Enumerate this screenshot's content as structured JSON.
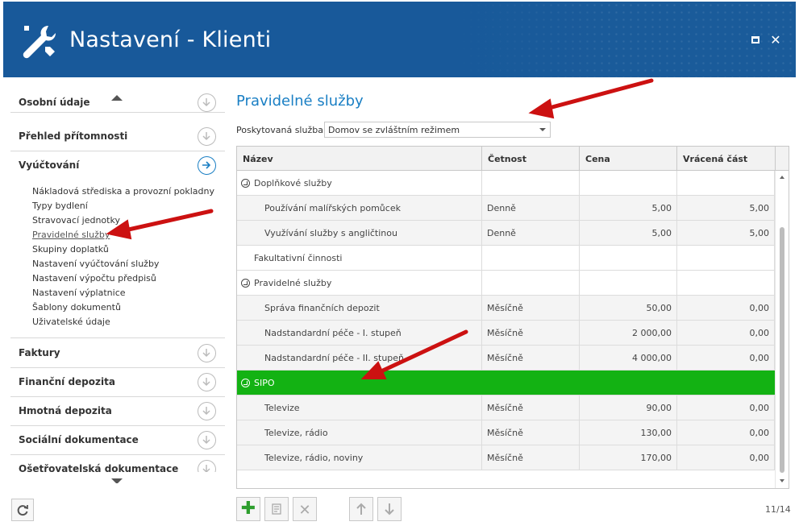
{
  "window": {
    "title": "Nastavení - Klienti",
    "icon": "wrench-screwdriver-icon",
    "title_color": "#1a5b9a"
  },
  "sidebar": {
    "sections_top": [
      {
        "label": "Osobní údaje"
      },
      {
        "label": "Přehled přítomnosti"
      },
      {
        "label": "Vyúčtování",
        "expanded": true
      }
    ],
    "subitems": [
      {
        "label": "Nákladová střediska a provozní pokladny"
      },
      {
        "label": "Typy bydlení"
      },
      {
        "label": "Stravovací jednotky"
      },
      {
        "label": "Pravidelné služby",
        "selected": true
      },
      {
        "label": "Skupiny doplatků"
      },
      {
        "label": "Nastavení vyúčtování služby"
      },
      {
        "label": "Nastavení výpočtu předpisů"
      },
      {
        "label": "Nastavení výplatnice"
      },
      {
        "label": "Šablony dokumentů"
      },
      {
        "label": "Uživatelské údaje"
      }
    ],
    "sections_bottom": [
      {
        "label": "Faktury"
      },
      {
        "label": "Finanční depozita"
      },
      {
        "label": "Hmotná depozita"
      },
      {
        "label": "Sociální dokumentace"
      },
      {
        "label": "Ošetřovatelská dokumentace"
      }
    ]
  },
  "main": {
    "title": "Pravidelné služby",
    "filter": {
      "label": "Poskytovaná služba:",
      "value": "Domov se zvláštním režimem"
    },
    "columns": [
      "Název",
      "Četnost",
      "Cena",
      "Vrácená část"
    ],
    "rows": [
      {
        "type": "group",
        "name": "Doplňkové služby",
        "freq": "",
        "price": "",
        "refund": ""
      },
      {
        "type": "item",
        "name": "Používání malířských pomůcek",
        "freq": "Denně",
        "price": "5,00",
        "refund": "5,00"
      },
      {
        "type": "item",
        "name": "Využívání služby s angličtinou",
        "freq": "Denně",
        "price": "5,00",
        "refund": "5,00"
      },
      {
        "type": "group-noicon",
        "name": "Fakultativní činnosti",
        "freq": "",
        "price": "",
        "refund": ""
      },
      {
        "type": "group",
        "name": "Pravidelné služby",
        "freq": "",
        "price": "",
        "refund": ""
      },
      {
        "type": "item",
        "name": "Správa finančních depozit",
        "freq": "Měsíčně",
        "price": "50,00",
        "refund": "0,00"
      },
      {
        "type": "item",
        "name": "Nadstandardní péče - I. stupeň",
        "freq": "Měsíčně",
        "price": "2 000,00",
        "refund": "0,00"
      },
      {
        "type": "item",
        "name": "Nadstandardní péče - II. stupeň",
        "freq": "Měsíčně",
        "price": "4 000,00",
        "refund": "0,00"
      },
      {
        "type": "selected",
        "name": "SIPO",
        "freq": "",
        "price": "",
        "refund": ""
      },
      {
        "type": "item",
        "name": "Televize",
        "freq": "Měsíčně",
        "price": "90,00",
        "refund": "0,00"
      },
      {
        "type": "item",
        "name": "Televize, rádio",
        "freq": "Měsíčně",
        "price": "130,00",
        "refund": "0,00"
      },
      {
        "type": "item",
        "name": "Televize, rádio, noviny",
        "freq": "Měsíčně",
        "price": "170,00",
        "refund": "0,00"
      }
    ],
    "selected_color": "#13b213",
    "pager": "11/14"
  },
  "toolbar": {
    "buttons": [
      "add-icon",
      "edit-icon",
      "delete-icon",
      "move-up-icon",
      "move-down-icon"
    ]
  }
}
